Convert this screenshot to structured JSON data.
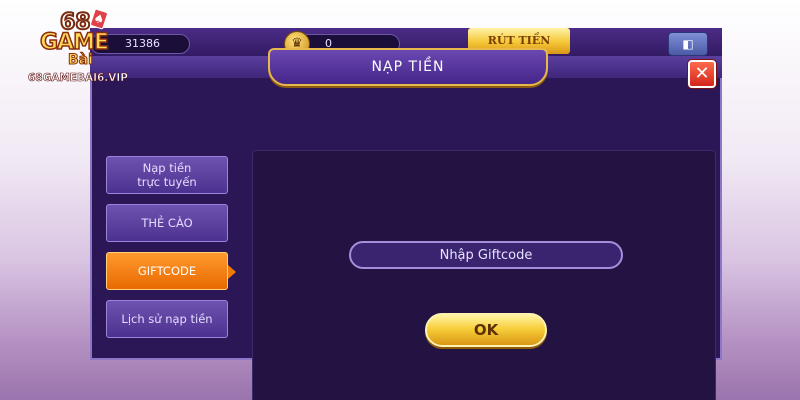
{
  "logo": {
    "number": "68",
    "game": "GAME",
    "bai": "Bài",
    "url": "68GAMEBAI6.VIP"
  },
  "topbar": {
    "balance": "31386",
    "gold": "0",
    "cashout_label": "RÚT TIỀN"
  },
  "dialog": {
    "title": "NẠP TIỀN",
    "close_symbol": "✕"
  },
  "sidebar": {
    "items": [
      {
        "label_line1": "Nạp tiền",
        "label_line2": "trực tuyến",
        "active": false
      },
      {
        "label_line1": "THẺ CÀO",
        "label_line2": "",
        "active": false
      },
      {
        "label_line1": "GIFTCODE",
        "label_line2": "",
        "active": true
      },
      {
        "label_line1": "Lịch sử nạp tiền",
        "label_line2": "",
        "active": false
      }
    ]
  },
  "giftcode": {
    "placeholder": "Nhập Giftcode",
    "ok_label": "OK"
  },
  "icons": {
    "close": "close-icon",
    "crown": "crown-icon",
    "menu": "menu-icon"
  },
  "colors": {
    "accent_gold": "#f4c736",
    "active_tab": "#ff9a2e",
    "dialog_bg": "#2b1656",
    "close_red": "#d2261a"
  }
}
